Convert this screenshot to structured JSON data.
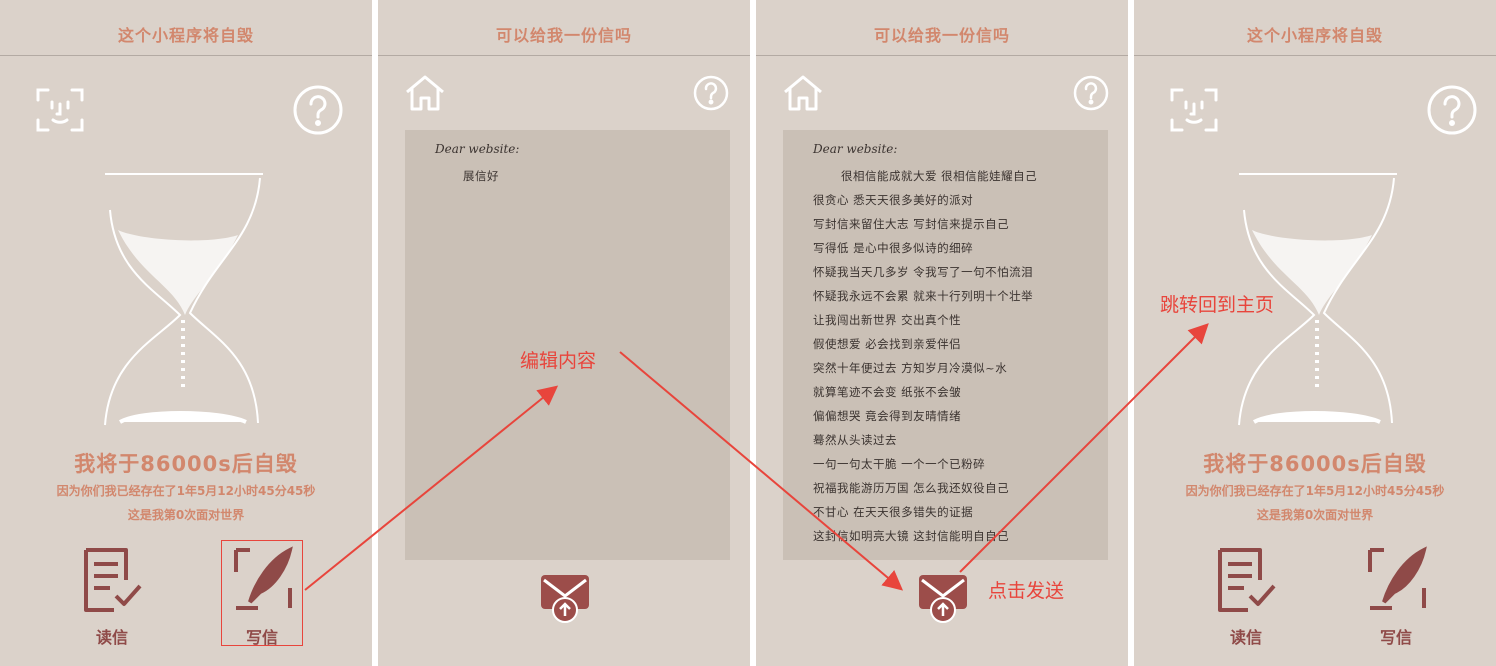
{
  "screens": {
    "home": {
      "title": "这个小程序将自毁",
      "status_main": "我将于86000s后自毁",
      "status_sub1": "因为你们我已经存在了1年5月12小时45分45秒",
      "status_sub2": "这是我第0次面对世界",
      "read_label": "读信",
      "write_label": "写信"
    },
    "compose_empty": {
      "title": "可以给我一份信吗",
      "greeting": "Dear  website:",
      "body": [
        "展信好"
      ]
    },
    "compose_filled": {
      "title": "可以给我一份信吗",
      "greeting": "Dear  website:",
      "body": [
        "很相信能成就大爱  很相信能娃耀自己",
        "很贪心  悉天天很多美好的派对",
        "写封信来留住大志  写封信来提示自己",
        "写得低  是心中很多似诗的细碎",
        "怀疑我当天几多岁  令我写了一句不怕流泪",
        "怀疑我永远不会累  就来十行列明十个壮举",
        "让我闯出新世界  交出真个性",
        "假使想爱  必会找到亲爱伴侣",
        "突然十年便过去  方知岁月冷漠似~水",
        "就算笔迹不会变  纸张不会皱",
        "偏偏想哭  竟会得到友晴情绪",
        "蓦然从头读过去",
        "一句一句太干脆  一个一个已粉碎",
        "祝福我能游历万国  怎么我还奴役自己",
        "不甘心  在天天很多错失的证据",
        "这封信如明亮大镜  这封信能明自自己"
      ]
    },
    "home_after": {
      "title": "这个小程序将自毁",
      "status_main": "我将于86000s后自毁",
      "status_sub1": "因为你们我已经存在了1年5月12小时45分45秒",
      "status_sub2": "这是我第0次面对世界",
      "read_label": "读信",
      "write_label": "写信"
    }
  },
  "annotations": {
    "edit": "编辑内容",
    "send": "点击发送",
    "jump": "跳转回到主页"
  },
  "icons": {
    "face_scan": "face-scan-icon",
    "help": "help-icon",
    "home": "home-icon",
    "read": "read-letter-icon",
    "write": "quill-icon",
    "send": "send-mail-icon"
  },
  "colors": {
    "background": "#dbd2ca",
    "title": "#d2876d",
    "action": "#8f4a48",
    "paper": "#cac0b6",
    "annotation": "#e8453c"
  }
}
